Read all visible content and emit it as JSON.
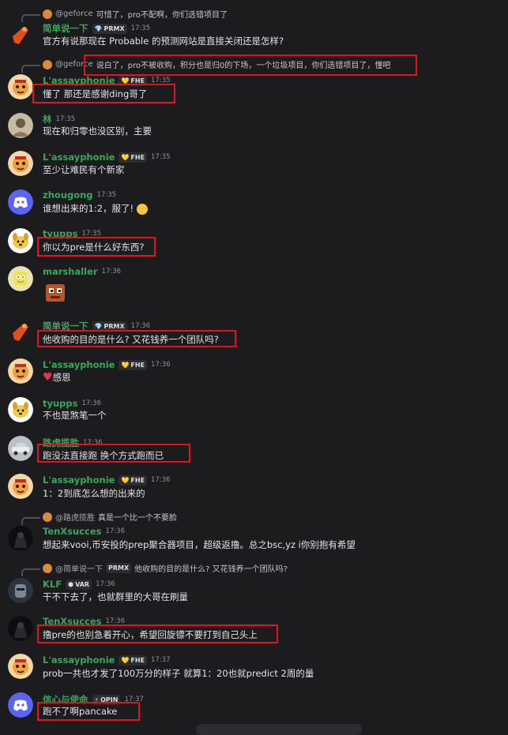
{
  "colors": {
    "background": "#1c1c1f",
    "username_green": "#3ba55d",
    "username_blue": "#5b9bd5",
    "highlight_red": "#e0141e",
    "discord_blurple": "#5865f2"
  },
  "messages": [
    {
      "reply": {
        "user": "@geforce",
        "text": "可惜了，pro不配啊，你们选错项目了"
      },
      "user": "简单说一下",
      "badge": "PRMX",
      "badge_icon": "gem-icon",
      "time": "17:35",
      "text": "官方有说那现在 Probable 的预测网站是直接关闭还是怎样?",
      "avatar": "orange-dancer-avatar"
    },
    {
      "reply": {
        "user": "@geforce",
        "text": "说白了，pro不被收购，积分也是归0的下场，一个垃圾项目，你们选错项目了，懂吧"
      },
      "user": "L'assayphonie",
      "badge": "FHE",
      "badge_icon": "heart-icon",
      "time": "17:35",
      "text": "懂了  那还是感谢ding哥了",
      "avatar": "tiger-avatar"
    },
    {
      "user": "林",
      "time": "17:35",
      "text": "现在和归零也没区别，主要",
      "avatar": "person-avatar"
    },
    {
      "user": "L'assayphonie",
      "badge": "FHE",
      "badge_icon": "heart-icon",
      "time": "17:35",
      "text": "至少让难民有个新家",
      "avatar": "tiger-avatar"
    },
    {
      "user": "zhougong",
      "time": "17:35",
      "text": "谁想出来的1:2，服了!",
      "avatar": "discord-avatar"
    },
    {
      "user": "tyupps",
      "time": "17:35",
      "text": "你以为pre是什么好东西?",
      "avatar": "dog-avatar"
    },
    {
      "user": "marshaller",
      "time": "17:36",
      "avatar": "sponge-avatar",
      "emoji": "pixel-creature-sticker"
    },
    {
      "user": "简单说一下",
      "badge": "PRMX",
      "badge_icon": "gem-icon",
      "time": "17:36",
      "text": "他收购的目的是什么? 又花钱养一个团队吗?",
      "avatar": "orange-dancer-avatar"
    },
    {
      "user": "L'assayphonie",
      "badge": "FHE",
      "badge_icon": "heart-icon",
      "time": "17:36",
      "text": "感恩",
      "avatar": "tiger-avatar"
    },
    {
      "user": "tyupps",
      "time": "17:36",
      "text": "不也是煞笔一个",
      "avatar": "dog-avatar"
    },
    {
      "user": "路虎揽胜",
      "time": "17:36",
      "text": "跑没法直接跑 换个方式跑而已",
      "avatar": "car-avatar"
    },
    {
      "user": "L'assayphonie",
      "badge": "FHE",
      "badge_icon": "heart-icon",
      "time": "17:36",
      "text": "1：2到底怎么想的出来的",
      "avatar": "tiger-avatar"
    },
    {
      "reply": {
        "user": "@路虎揽胜",
        "text": "真是一个比一个不要脸"
      },
      "user": "TenXsucces",
      "time": "17:36",
      "text": "想起来vooi,币安投的prep聚合器项目，超级返撸。总之bsc,yz i你别抱有希望",
      "avatar": "dark-figure-avatar"
    },
    {
      "reply": {
        "user": "@简单说一下",
        "badge": "PRMX",
        "text": "他收购的目的是什么? 又花钱养一个团队吗?"
      },
      "user": "KLF",
      "badge": "VAR",
      "badge_icon": "hexagon-icon",
      "time": "17:36",
      "text": "干不下去了，也就群里的大哥在刷量",
      "avatar": "armor-avatar"
    },
    {
      "user": "TenXsucces",
      "time": "17:36",
      "text": "撸pre的也别急着开心，希望回旋镖不要打到自己头上",
      "avatar": "dark-figure-avatar"
    },
    {
      "user": "L'assayphonie",
      "badge": "FHE",
      "badge_icon": "heart-icon",
      "time": "17:37",
      "text": "prob一共也才发了100万分的样子  就算1：20也就predict 2周的量",
      "avatar": "tiger-avatar"
    },
    {
      "user": "信心与使命",
      "badge": "OPIN",
      "badge_icon": "bolt-icon",
      "time": "17:37",
      "text": "跑不了啊pancake",
      "avatar": "discord-avatar"
    }
  ]
}
